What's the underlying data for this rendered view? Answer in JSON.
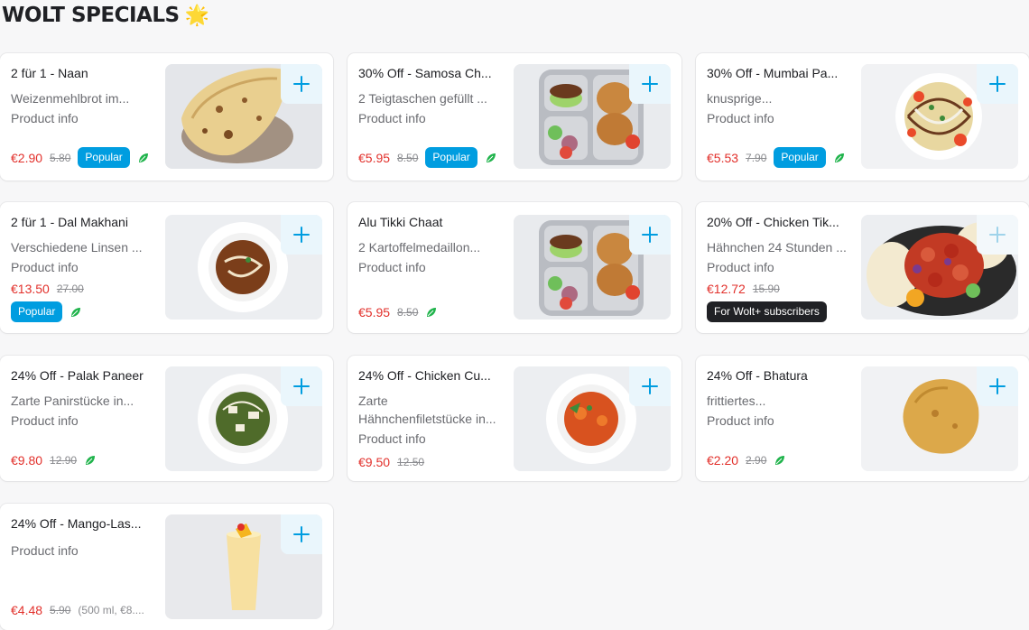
{
  "section": {
    "title": "WOLT SPECIALS",
    "emoji": "🌟"
  },
  "colors": {
    "accent": "#009de0",
    "price": "#e2302b",
    "leaf": "#1fb34b"
  },
  "items": [
    {
      "name": "2 für 1 - Naan",
      "desc": "Weizenmehlbrot im...",
      "info": "Product info",
      "price": "€2.90",
      "old": "5.80",
      "badge": "Popular",
      "image": "naan"
    },
    {
      "name": "30% Off - Samosa Ch...",
      "desc": "2 Teigtaschen gefüllt ...",
      "info": "Product info",
      "price": "€5.95",
      "old": "8.50",
      "badge": "Popular",
      "image": "thali"
    },
    {
      "name": "30% Off - Mumbai Pa...",
      "desc": "knusprige...",
      "info": "Product info",
      "price": "€5.53",
      "old": "7.90",
      "badge": "Popular",
      "image": "papdi"
    },
    {
      "name": "2 für 1 - Dal Makhani",
      "desc": "Verschiedene Linsen ...",
      "info": "Product info",
      "price": "€13.50",
      "old": "27.00",
      "badge": "Popular",
      "image": "dal"
    },
    {
      "name": "Alu Tikki Chaat",
      "desc": "2 Kartoffelmedaillon...",
      "info": "Product info",
      "price": "€5.95",
      "old": "8.50",
      "badge": "",
      "image": "thali"
    },
    {
      "name": "20% Off - Chicken Tik...",
      "desc": "Hähnchen 24 Stunden ...",
      "info": "Product info",
      "price": "€12.72",
      "old": "15.90",
      "badge": "For Wolt+ subscribers",
      "image": "tikka"
    },
    {
      "name": "24% Off - Palak Paneer",
      "desc": "Zarte Panirstücke in...",
      "info": "Product info",
      "price": "€9.80",
      "old": "12.90",
      "badge": "",
      "image": "palak"
    },
    {
      "name": "24% Off - Chicken Cu...",
      "desc": "Zarte Hähnchenfiletstücke in...",
      "info": "Product info",
      "price": "€9.50",
      "old": "12.50",
      "badge": "",
      "image": "curry"
    },
    {
      "name": "24% Off - Bhatura",
      "desc": "frittiertes...",
      "info": "Product info",
      "price": "€2.20",
      "old": "2.90",
      "badge": "",
      "image": "bhatura"
    },
    {
      "name": "24% Off - Mango-Las...",
      "desc": "",
      "info": "Product info",
      "price": "€4.48",
      "old": "5.90",
      "unit": "(500 ml, €8....",
      "badge": "",
      "image": "lassi"
    }
  ]
}
